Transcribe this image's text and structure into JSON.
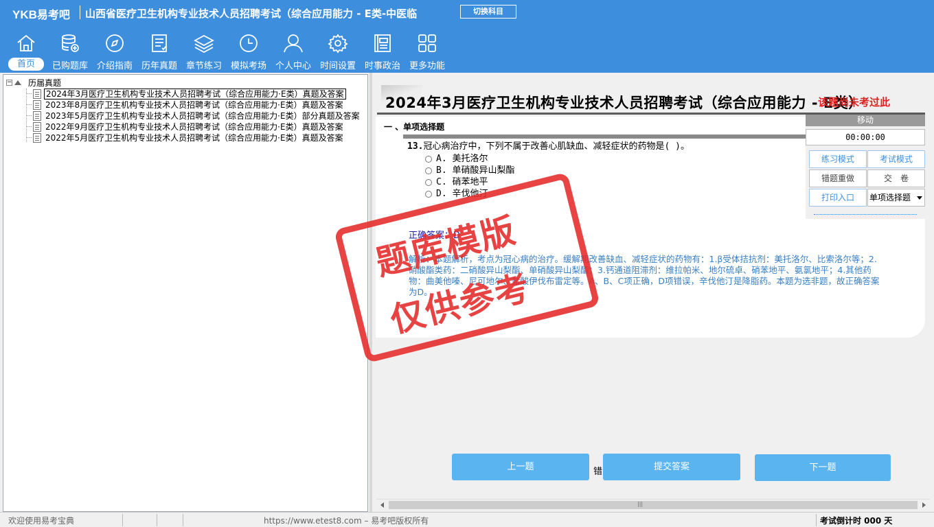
{
  "header": {
    "logo_latin": "YKB",
    "logo_cn": "易考吧",
    "exam_title": "山西省医疗卫生机构专业技术人员招聘考试（综合应用能力 - E类-中医临",
    "switch_label": "切换科目"
  },
  "nav": [
    {
      "label": "首页",
      "icon": "home-icon",
      "active": true
    },
    {
      "label": "已购题库",
      "icon": "database-icon"
    },
    {
      "label": "介绍指南",
      "icon": "compass-icon"
    },
    {
      "label": "历年真题",
      "icon": "document-list-icon"
    },
    {
      "label": "章节练习",
      "icon": "layers-icon"
    },
    {
      "label": "模拟考场",
      "icon": "clock-icon"
    },
    {
      "label": "个人中心",
      "icon": "user-icon"
    },
    {
      "label": "时间设置",
      "icon": "gear-icon"
    },
    {
      "label": "时事政治",
      "icon": "news-icon"
    },
    {
      "label": "更多功能",
      "icon": "grid-icon"
    }
  ],
  "tree": {
    "root_label": "历届真题",
    "items": [
      {
        "label": "2024年3月医疗卫生机构专业技术人员招聘考试（综合应用能力·E类）真题及答案",
        "selected": true
      },
      {
        "label": "2023年8月医疗卫生机构专业技术人员招聘考试（综合应用能力·E类）真题及答案"
      },
      {
        "label": "2023年5月医疗卫生机构专业技术人员招聘考试（综合应用能力·E类）部分真题及答案"
      },
      {
        "label": "2022年9月医疗卫生机构专业技术人员招聘考试（综合应用能力·E类）真题及答案"
      },
      {
        "label": "2022年5月医疗卫生机构专业技术人员招聘考试（综合应用能力·E类）真题及答案"
      }
    ]
  },
  "paper": {
    "title": "2024年3月医疗卫生机构专业技术人员招聘考试（综合应用能力 - E类）",
    "note": "该题尚未考过此"
  },
  "question": {
    "section": "一 、单项选择题",
    "number": "13.",
    "stem": "冠心病治疗中，下列不属于改善心肌缺血、减轻症状的药物是( )。",
    "options": [
      {
        "key": "A.",
        "text": "美托洛尔"
      },
      {
        "key": "B.",
        "text": "单硝酸异山梨酯"
      },
      {
        "key": "C.",
        "text": "硝苯地平"
      },
      {
        "key": "D.",
        "text": "辛伐他汀"
      }
    ],
    "answer": "正确答案：D",
    "analysis": "解析：本题解析，考点为冠心病的治疗。缓解期改善缺血、减轻症状的药物有：1.β受体拮抗剂：美托洛尔、比索洛尔等；2.硝酸酯类药：二硝酸异山梨酯、单硝酸异山梨酯；3.钙通道阻滞剂：维拉帕米、地尔硫卓、硝苯地平、氨氯地平；4.其他药物：曲美他嗪、尼可地尔、盐酸伊伐布雷定等。A、B、C项正确，D项错误，辛伐他汀是降脂药。本题为选非题，故正确答案为D。"
  },
  "control": {
    "move_label": "移动",
    "timer": "00:00:00",
    "practice_mode": "练习模式",
    "exam_mode": "考试模式",
    "redo_wrong": "错题重做",
    "submit_paper": "交　卷",
    "print_entry": "打印入口",
    "type_select": "单项选择题"
  },
  "bottom": {
    "prev": "上一题",
    "submit": "提交答案",
    "next": "下一题",
    "err_label": "错"
  },
  "status": {
    "welcome": "欢迎使用易考宝典",
    "copyright": "https://www.etest8.com – 易考吧版权所有",
    "countdown": "考试倒计时 000 天"
  },
  "watermark": {
    "line1": "题库模版",
    "line2": "仅供参考"
  },
  "colors": {
    "brand": "#3d8fde",
    "button": "#5ab4f0",
    "stamp": "#e52a2a",
    "analysis": "#3a7fc2"
  }
}
